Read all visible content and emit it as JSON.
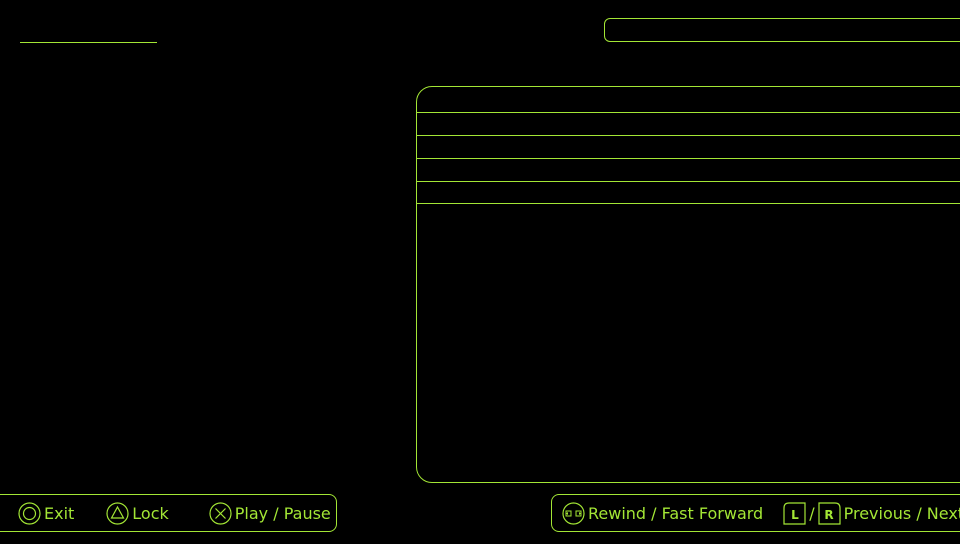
{
  "theme": {
    "accent": "#a3e635",
    "background": "#000000"
  },
  "controls": {
    "left": [
      {
        "icon": "circle-button-icon",
        "label": "Exit"
      },
      {
        "icon": "triangle-button-icon",
        "label": "Lock"
      },
      {
        "icon": "cross-button-icon",
        "label": "Play / Pause"
      }
    ],
    "right": {
      "rewind": {
        "icon": "rewind-fastforward-icon",
        "label": "Rewind / Fast Forward"
      },
      "nav": {
        "l_key": "L",
        "separator": "/",
        "r_key": "R",
        "label": "Previous / Next"
      }
    }
  }
}
